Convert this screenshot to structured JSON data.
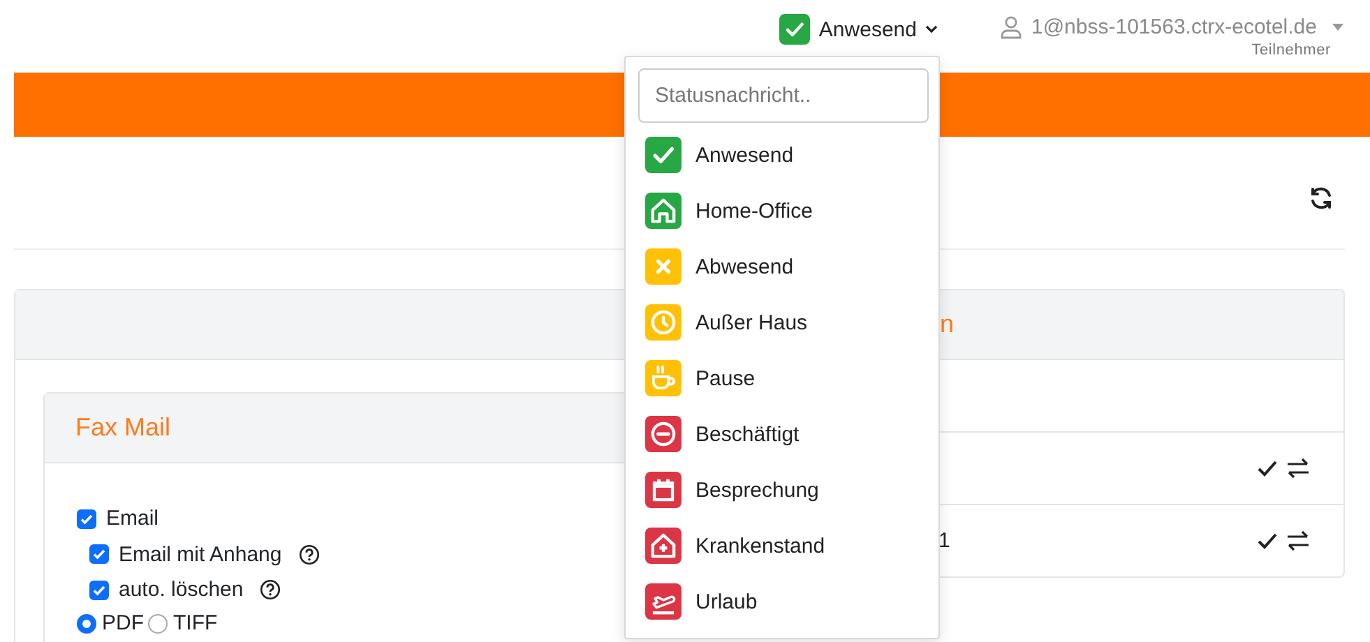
{
  "header": {
    "status": {
      "kind": "check",
      "label": "Anwesend",
      "color": "#28a745"
    },
    "user": {
      "email": "1@nbss-101563.ctrx-ecotel.de",
      "role": "Teilnehmer"
    }
  },
  "status_menu": {
    "placeholder": "Statusnachricht..",
    "items": [
      {
        "kind": "check",
        "label": "Anwesend",
        "color": "#28a745"
      },
      {
        "kind": "home",
        "label": "Home-Office",
        "color": "#28a745"
      },
      {
        "kind": "cross",
        "label": "Abwesend",
        "color": "#ffc107"
      },
      {
        "kind": "clock",
        "label": "Außer Haus",
        "color": "#ffc107"
      },
      {
        "kind": "cup",
        "label": "Pause",
        "color": "#ffc107"
      },
      {
        "kind": "minus",
        "label": "Beschäftigt",
        "color": "#dc3545"
      },
      {
        "kind": "calendar",
        "label": "Besprechung",
        "color": "#dc3545"
      },
      {
        "kind": "hospital",
        "label": "Krankenstand",
        "color": "#dc3545"
      },
      {
        "kind": "plane",
        "label": "Urlaub",
        "color": "#dc3545"
      }
    ]
  },
  "fax_mail": {
    "title": "Fax Mail",
    "options": [
      {
        "label": "Email",
        "checked": true,
        "help": false,
        "children": [
          {
            "label": "Email mit Anhang",
            "checked": true,
            "help": true
          },
          {
            "label": "auto. löschen",
            "checked": true,
            "help": true
          }
        ]
      }
    ],
    "formats": [
      {
        "label": "PDF",
        "selected": true
      },
      {
        "label": "TIFF",
        "selected": false
      }
    ]
  },
  "right_card": {
    "title": "n",
    "rows": [
      {
        "kind": "empty"
      },
      {
        "kind": "actions"
      },
      {
        "kind": "actions",
        "column_1": "1"
      }
    ]
  }
}
